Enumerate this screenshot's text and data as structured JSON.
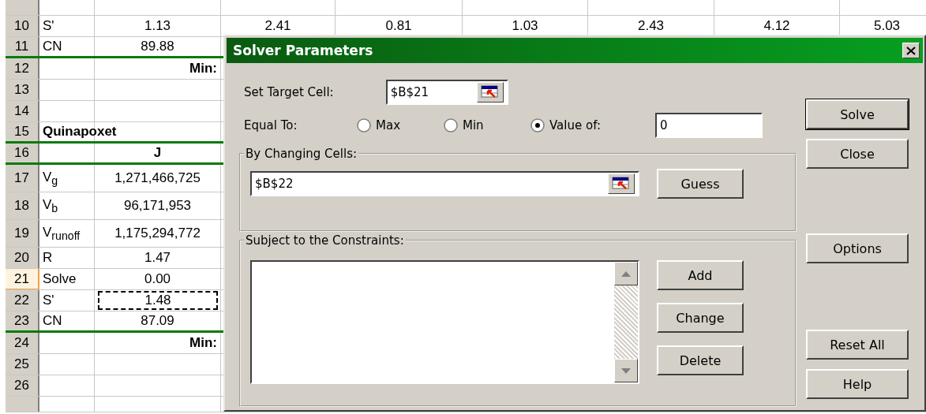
{
  "sheet": {
    "rows": [
      {
        "number": "10",
        "kind": "data",
        "label": "S'",
        "value": "1.13",
        "more": [
          "2.41",
          "0.81",
          "1.03",
          "2.43",
          "4.12",
          "5.03"
        ],
        "rule_below": false,
        "selected": false,
        "marquee": false
      },
      {
        "number": "11",
        "kind": "data",
        "label": "CN",
        "value": "89.88",
        "rule_below": true,
        "selected": false,
        "marquee": false
      },
      {
        "number": "12",
        "kind": "min",
        "value": "Min:",
        "rule_below": false,
        "selected": false
      },
      {
        "number": "13",
        "kind": "blank",
        "rule_below": false,
        "selected": false
      },
      {
        "number": "14",
        "kind": "blank",
        "rule_below": false,
        "selected": false
      },
      {
        "number": "15",
        "kind": "title",
        "label": "Quinapoxet",
        "rule_below": true,
        "selected": false
      },
      {
        "number": "16",
        "kind": "column_head",
        "value": "J",
        "rule_below": true,
        "selected": false
      },
      {
        "number": "17",
        "kind": "var",
        "label": "V$_{g}$",
        "value": "1,271,466,725",
        "rule_below": false,
        "selected": false,
        "marquee": false
      },
      {
        "number": "18",
        "kind": "var",
        "label": "V$_{b}$",
        "value": "96,171,953",
        "rule_below": false,
        "selected": false,
        "marquee": false
      },
      {
        "number": "19",
        "kind": "var",
        "label": "V$_{runoff}$",
        "value": "1,175,294,772",
        "rule_below": false,
        "selected": false,
        "marquee": false
      },
      {
        "number": "20",
        "kind": "data",
        "label": "R",
        "value": "1.47",
        "rule_below": false,
        "selected": false,
        "marquee": false
      },
      {
        "number": "21",
        "kind": "data",
        "label": "Solve",
        "value": "0.00",
        "rule_below": false,
        "selected": true,
        "marquee": false
      },
      {
        "number": "22",
        "kind": "data",
        "label": "S'",
        "value": "1.48",
        "rule_below": false,
        "selected": false,
        "marquee": true
      },
      {
        "number": "23",
        "kind": "data",
        "label": "CN",
        "value": "87.09",
        "rule_below": true,
        "selected": false,
        "marquee": false
      },
      {
        "number": "24",
        "kind": "min",
        "value": "Min:",
        "rule_below": false,
        "selected": false
      },
      {
        "number": "25",
        "kind": "blank",
        "rule_below": false,
        "selected": false
      },
      {
        "number": "26",
        "kind": "blank",
        "rule_below": false,
        "selected": false
      }
    ]
  },
  "dialog": {
    "title": "Solver Parameters",
    "target_label": "Set Target Cell:",
    "target_value": "$B$21",
    "equal_label": "Equal To:",
    "options": [
      {
        "label": "Max",
        "selected": false
      },
      {
        "label": "Min",
        "selected": false
      },
      {
        "label": "Value of:",
        "selected": true
      }
    ],
    "value_of": "0",
    "changing_group": "By Changing Cells:",
    "changing_value": "$B$22",
    "guess": "Guess",
    "constraints_group": "Subject to the Constraints:",
    "constraint_buttons": [
      "Add",
      "Change",
      "Delete"
    ],
    "side_buttons": [
      {
        "label": "Solve",
        "default": true
      },
      {
        "label": "Close",
        "default": false
      },
      {
        "label": "Options",
        "default": false
      },
      {
        "label": "Reset All",
        "default": false
      },
      {
        "label": "Help",
        "default": false
      }
    ]
  }
}
